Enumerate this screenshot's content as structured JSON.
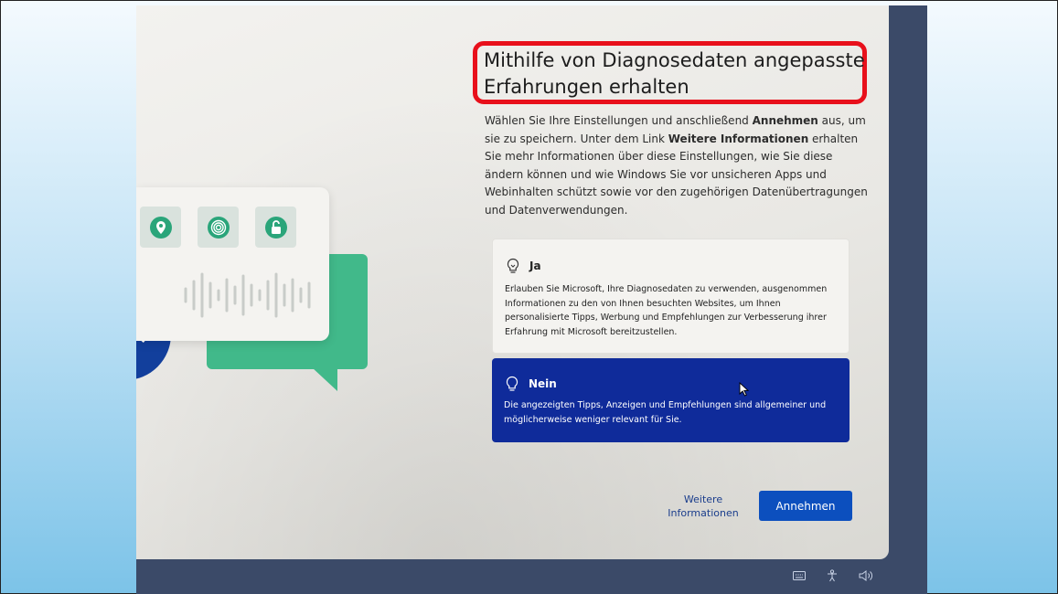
{
  "page": {
    "title": "Mithilfe von Diagnosedaten angepasste Erfahrungen erhalten",
    "description_html": "Wählen Sie Ihre Einstellungen und anschließend <b>Annehmen</b> aus, um sie zu speichern. Unter dem Link <b>Weitere Informationen</b> erhalten Sie mehr Informationen über diese Einstellungen, wie Sie diese ändern können und wie Windows Sie vor unsicheren Apps und Webinhalten schützt sowie vor den zugehörigen Datenübertragungen und Datenverwendungen."
  },
  "options": [
    {
      "label": "Ja",
      "icon": "lightbulb-on-icon",
      "selected": false,
      "text": "Erlauben Sie Microsoft, Ihre Diagnosedaten zu verwenden, ausgenommen Informationen zu den von Ihnen besuchten Websites, um Ihnen personalisierte Tipps, Werbung und Empfehlungen zur Verbesserung ihrer Erfahrung mit Microsoft bereitzustellen."
    },
    {
      "label": "Nein",
      "icon": "lightbulb-off-icon",
      "selected": true,
      "text": "Die angezeigten Tipps, Anzeigen und Empfehlungen sind allgemeiner und möglicherweise weniger relevant für Sie."
    }
  ],
  "footer": {
    "more_info_line1": "Weitere",
    "more_info_line2": "Informationen",
    "accept_label": "Annehmen"
  },
  "tray_icons": [
    "keyboard-icon",
    "accessibility-icon",
    "volume-icon"
  ],
  "colors": {
    "highlight": "#e8101b",
    "selected_option": "#0f2b9a",
    "accept_button": "#0c4fbe",
    "illustration_green": "#41b98a",
    "shield_blue": "#123f9c",
    "slide_background_bottom": "#7cc3e8"
  }
}
